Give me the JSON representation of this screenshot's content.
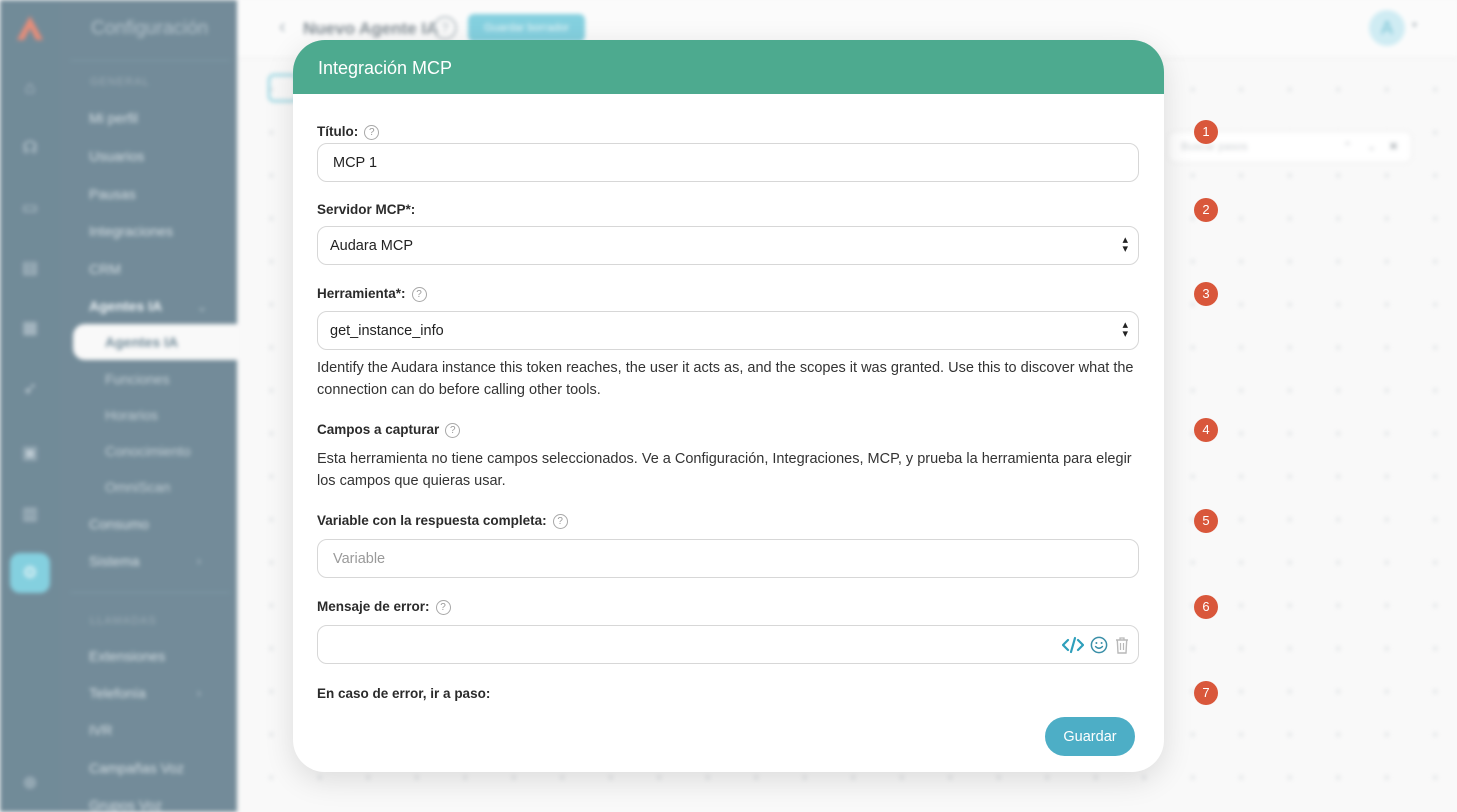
{
  "sidebar": {
    "title": "Configuración",
    "section_general": "GENERAL",
    "items": [
      "Mi perfil",
      "Usuarios",
      "Pausas",
      "Integraciones",
      "CRM"
    ],
    "ai_agents_group": "Agentes IA",
    "sub_items": [
      "Agentes IA",
      "Funciones",
      "Horarios",
      "Conocimiento",
      "OmniScan"
    ],
    "items2": [
      "Consumo",
      "Sistema"
    ],
    "section_calls": "LLAMADAS",
    "items3": [
      "Extensiones",
      "Telefonía",
      "IVR",
      "Campañas Voz",
      "Grupos Voz"
    ]
  },
  "topbar": {
    "page_name": "Nuevo Agente IA",
    "help": "?",
    "draft_button": "Guardar borrador",
    "avatar_letter": "A"
  },
  "canvas": {
    "search_placeholder": "Buscar pasos"
  },
  "markers": [
    "1",
    "2",
    "3",
    "4",
    "5",
    "6",
    "7"
  ],
  "modal": {
    "title": "Integración MCP",
    "title_label": "Título:",
    "title_value": "MCP 1",
    "server_label": "Servidor MCP*:",
    "server_value": "Audara MCP",
    "tool_label": "Herramienta*:",
    "tool_value": "get_instance_info",
    "tool_description": "Identify the Audara instance this token reaches, the user it acts as, and the scopes it was granted. Use this to discover what the connection can do before calling other tools.",
    "fields_label": "Campos a capturar",
    "fields_text": "Esta herramienta no tiene campos seleccionados. Ve a Configuración, Integraciones, MCP, y prueba la herramienta para elegir los campos que quieras usar.",
    "variable_label": "Variable con la respuesta completa:",
    "variable_placeholder": "Variable",
    "error_label": "Mensaje de error:",
    "error_value": "",
    "on_error_label": "En caso de error, ir a paso:",
    "save_button": "Guardar"
  },
  "colors": {
    "modal_header": "#4daa8f",
    "accent": "#4daec6",
    "marker": "#d9573b",
    "sidebar": "#315569"
  },
  "icons": [
    "code-icon",
    "emoji-icon",
    "trash-icon",
    "help-icon",
    "select-arrows-icon"
  ]
}
